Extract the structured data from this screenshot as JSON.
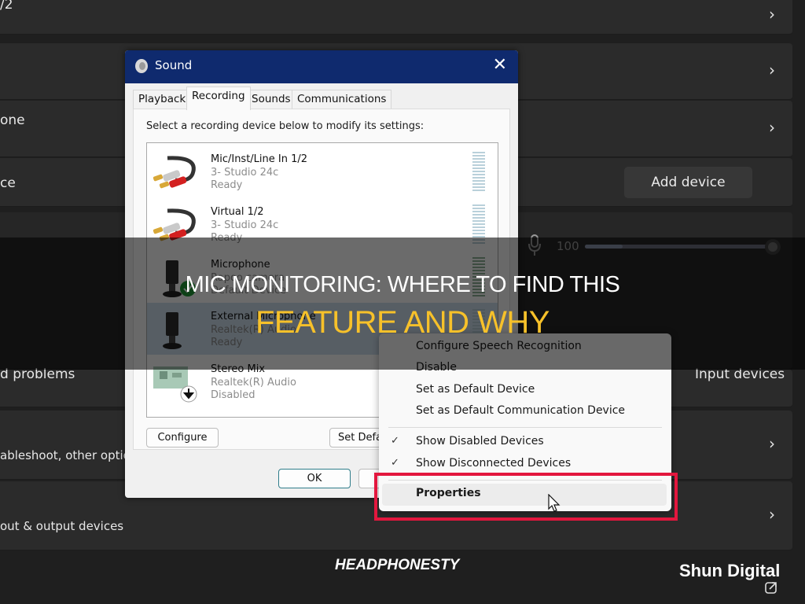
{
  "background_settings": {
    "rows": [
      {
        "label": "/2",
        "has_chevron": true
      },
      {
        "label": "",
        "has_chevron": true
      },
      {
        "label": "one",
        "has_chevron": true
      },
      {
        "label": "ce",
        "has_chevron": false
      },
      {
        "label": "d problems",
        "right_label": "Input devices",
        "has_chevron": false
      },
      {
        "label": "ableshoot, other options",
        "has_chevron": true
      },
      {
        "label": "out & output devices",
        "has_chevron": true
      }
    ],
    "add_device_label": "Add device",
    "volume": {
      "icon": "microphone-icon",
      "value_label": "100",
      "level_percent": 100
    }
  },
  "sound_dialog": {
    "title": "Sound",
    "close_icon": "close-icon",
    "tabs": [
      {
        "label": "Playback",
        "active": false
      },
      {
        "label": "Recording",
        "active": true
      },
      {
        "label": "Sounds",
        "active": false
      },
      {
        "label": "Communications",
        "active": false
      }
    ],
    "instruction": "Select a recording device below to modify its settings:",
    "devices": [
      {
        "name": "Mic/Inst/Line In 1/2",
        "sub": "3- Studio 24c",
        "status": "Ready",
        "icon": "rca-cable-icon"
      },
      {
        "name": "Virtual 1/2",
        "sub": "3- Studio 24c",
        "status": "Ready",
        "icon": "rca-cable-icon"
      },
      {
        "name": "Microphone",
        "sub": "Rapoo camera",
        "status": "Default Device",
        "icon": "microphone-device-icon",
        "badge": "default-check-icon"
      },
      {
        "name": "External Microphone",
        "sub": "Realtek(R) Audio",
        "status": "Ready",
        "icon": "microphone-device-icon",
        "selected": true
      },
      {
        "name": "Stereo Mix",
        "sub": "Realtek(R) Audio",
        "status": "Disabled",
        "icon": "sound-card-icon",
        "badge": "disabled-arrow-icon"
      }
    ],
    "buttons": {
      "configure": "Configure",
      "set_default": "Set Defa",
      "ok": "OK"
    }
  },
  "context_menu": {
    "items": [
      {
        "label": "Configure Speech Recognition",
        "checked": false
      },
      {
        "label": "Disable",
        "checked": false
      },
      {
        "label": "Set as Default Device",
        "checked": false
      },
      {
        "label": "Set as Default Communication Device",
        "checked": false
      },
      {
        "label": "Show Disabled Devices",
        "checked": true
      },
      {
        "label": "Show Disconnected Devices",
        "checked": true
      },
      {
        "label": "Properties",
        "checked": false,
        "highlighted": true
      }
    ],
    "check_glyph": "✓"
  },
  "banner": {
    "line1": "MIC MONITORING: WHERE TO FIND THIS",
    "line2": "FEATURE AND WHY",
    "line2_color": "#f7c12a"
  },
  "watermarks": {
    "left": "HEADPHONESTY",
    "right": "Shun Digital"
  },
  "colors": {
    "highlight_box": "#e3173e",
    "titlebar": "#0f2a6e"
  }
}
